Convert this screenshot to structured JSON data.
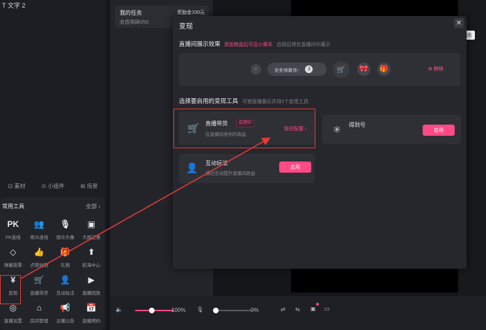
{
  "left": {
    "top_label": "T 文字 2",
    "tools": [
      "⊡ 素材",
      "⊙ 小插件",
      "⊞ 场景"
    ],
    "panel_title": "常用工具",
    "panel_all": "全部 ›",
    "tiles": [
      [
        {
          "label": "PK连线",
          "icon": "PK",
          "name": "pk-icon"
        },
        {
          "label": "观众连线",
          "icon": "👥",
          "name": "viewers-icon"
        },
        {
          "label": "观众头像",
          "icon": "🎙",
          "name": "mic-icon"
        },
        {
          "label": "大屏记录",
          "icon": "▣",
          "name": "screen-record-icon"
        }
      ],
      [
        {
          "label": "弹幕投票",
          "icon": "◇",
          "name": "vote-icon"
        },
        {
          "label": "点赞时刻",
          "icon": "👍",
          "name": "like-icon"
        },
        {
          "label": "礼物",
          "icon": "🎁",
          "name": "gift-icon"
        },
        {
          "label": "航海中心",
          "icon": "⬆",
          "name": "upload-icon"
        }
      ],
      [
        {
          "label": "变现",
          "icon": "¥",
          "name": "monetize-icon"
        },
        {
          "label": "直播带货",
          "icon": "🛒",
          "name": "cart-icon"
        },
        {
          "label": "互动玩法",
          "icon": "👤",
          "name": "interact-icon"
        },
        {
          "label": "直播回放",
          "icon": "▶",
          "name": "replay-icon"
        }
      ],
      [
        {
          "label": "直播设置",
          "icon": "◎",
          "name": "settings-icon"
        },
        {
          "label": "房间管理",
          "icon": "⌂",
          "name": "room-icon"
        },
        {
          "label": "主播公告",
          "icon": "📢",
          "name": "notice-icon"
        },
        {
          "label": "直播预约",
          "icon": "📅",
          "name": "schedule-icon"
        }
      ]
    ]
  },
  "task": {
    "title": "我的任务",
    "sub": "收音障碍0/50",
    "reward": "奖励金100元"
  },
  "tooltip": "关闭",
  "modal": {
    "title": "变现",
    "close": "✕",
    "sec1_title": "直播间展示效果",
    "sec1_hint_pink": "添加商品后可见小黄车",
    "sec1_hint_gray": "启用后将在直播间中展示",
    "sent_label": "发条弹幕领~",
    "sent_count": "3",
    "remove": "⊕ 移除",
    "sec2_title": "选择要启用的变现工具",
    "sec2_hint": "可使直播展示并排1个变现工具",
    "card1_name": "直播带货",
    "card1_badge": "启用中",
    "card1_sub": "在直播间卖你的商品",
    "card1_action": "前往配置 ›",
    "card2_name": "得到号",
    "card2_btn": "启用",
    "card3_name": "互动玩法",
    "card3_sub": "通过互动提升直播间收益",
    "card3_btn": "启用"
  },
  "bottom": {
    "volume1": "100%",
    "volume2": "0%"
  },
  "colors": {
    "accent": "#ff4a86",
    "highlight": "#e63b3b"
  }
}
